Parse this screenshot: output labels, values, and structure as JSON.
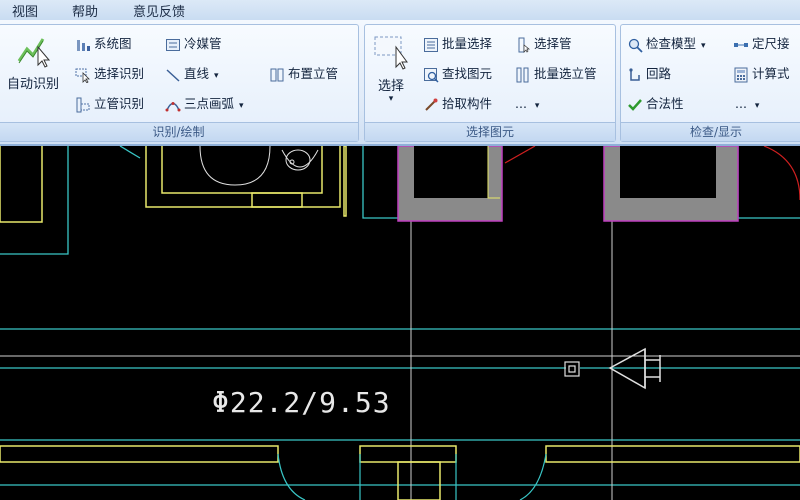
{
  "menu": {
    "view": "视图",
    "help": "帮助",
    "feedback": "意见反馈"
  },
  "ribbon": {
    "group1": {
      "label": "识别/绘制",
      "auto_identify": "自动识别",
      "system_diagram": "系统图",
      "refrigerant_pipe": "冷媒管",
      "select_identify": "选择识别",
      "line": "直线",
      "place_riser": "布置立管",
      "riser_identify": "立管识别",
      "three_point_arc": "三点画弧"
    },
    "group2": {
      "label": "选择图元",
      "select": "选择",
      "batch_select": "批量选择",
      "select_pipe": "选择管",
      "find_element": "查找图元",
      "batch_select_riser": "批量选立管",
      "pick_component": "拾取构件",
      "more": "..."
    },
    "group3": {
      "label": "检查/显示",
      "check_model": "检查模型",
      "dimension": "定尺接",
      "loop": "回路",
      "calc": "计算式",
      "validity": "合法性",
      "more": "..."
    }
  },
  "canvas": {
    "pipe_label": "Φ22.2/9.53"
  },
  "colors": {
    "ribbon_bg": "#dfeaf8",
    "cad_bg": "#000000",
    "yellow": "#e8e86a",
    "cyan": "#39c6c6",
    "magenta": "#c040c0"
  }
}
